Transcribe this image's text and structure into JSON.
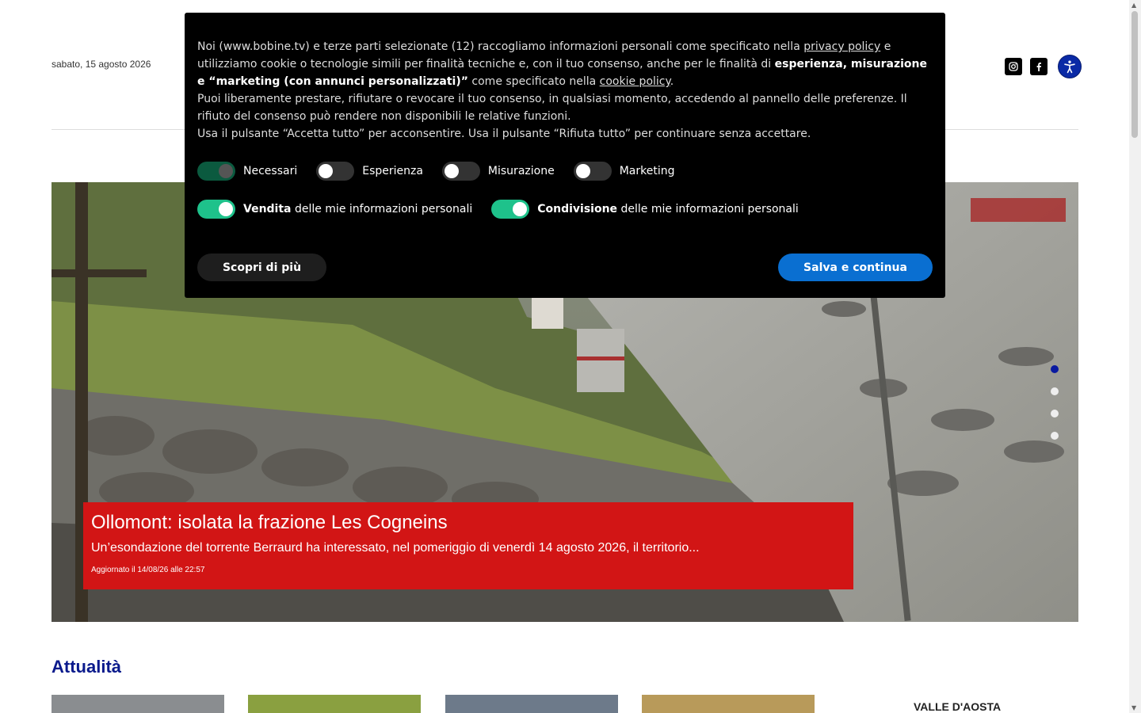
{
  "header": {
    "date": "sabato, 15 agosto 2026",
    "social": [
      {
        "icon": "instagram-icon"
      },
      {
        "icon": "facebook-icon"
      }
    ],
    "accessibility_icon": "accessibility-icon"
  },
  "hero": {
    "title": "Ollomont: isolata la frazione Les Cogneins",
    "summary": "Un’esondazione del torrente Berraurd ha interessato, nel pomeriggio di venerdì 14 agosto 2026, il territorio...",
    "updated": "Aggiornato il 14/08/26 alle 22:57",
    "slides_total": 4,
    "active_slide": 1
  },
  "section": {
    "title": "Attualità",
    "sidebar_title": "VALLE D'AOSTA"
  },
  "cookie": {
    "text_p1_a": "Noi (www.bobine.tv) e terze parti selezionate (12) raccogliamo informazioni personali come specificato nella ",
    "privacy_link": "privacy policy",
    "text_p1_b": " e utilizziamo cookie o tecnologie simili per finalità tecniche e, con il tuo consenso, anche per le finalità di ",
    "text_p1_bold": "esperienza, misurazione e “marketing (con annunci personalizzati)”",
    "text_p1_c": " come specificato nella ",
    "cookie_link": "cookie policy",
    "text_p1_d": ".",
    "text_p2": "Puoi liberamente prestare, rifiutare o revocare il tuo consenso, in qualsiasi momento, accedendo al pannello delle preferenze. Il rifiuto del consenso può rendere non disponibili le relative funzioni.",
    "text_p3": "Usa il pulsante “Accetta tutto” per acconsentire. Usa il pulsante “Rifiuta tutto” per continuare senza accettare.",
    "toggles": [
      {
        "label": "Necessari",
        "state": "locked"
      },
      {
        "label": "Esperienza",
        "state": "off"
      },
      {
        "label": "Misurazione",
        "state": "off"
      },
      {
        "label": "Marketing",
        "state": "off"
      }
    ],
    "sale_bold": "Vendita",
    "sale_rest": " delle mie informazioni personali",
    "share_bold": "Condivisione",
    "share_rest": " delle mie informazioni personali",
    "learn_more": "Scopri di più",
    "save": "Salva e continua"
  },
  "colors": {
    "accent_blue": "#0a1a8c",
    "caption_red": "#d21515",
    "toggle_on": "#1ec28b",
    "save_button": "#0a6fd1"
  }
}
